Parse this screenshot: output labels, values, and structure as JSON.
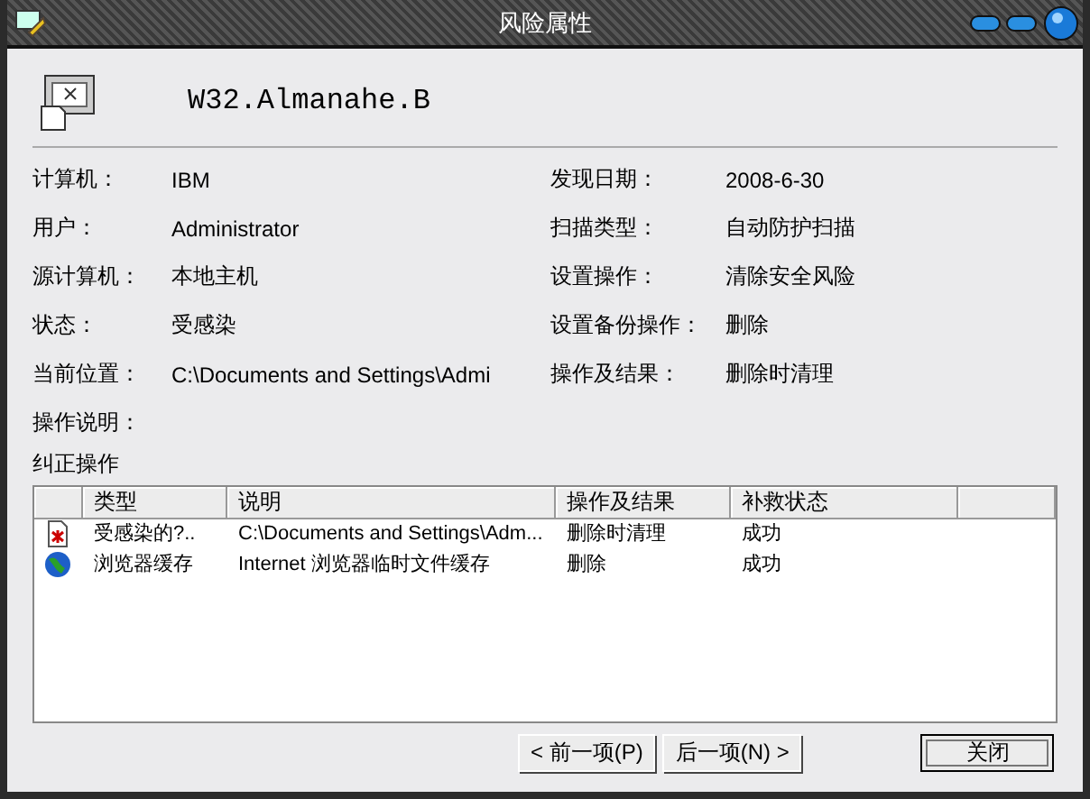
{
  "window": {
    "title": "风险属性"
  },
  "risk_name": "W32.Almanahe.B",
  "details_left": [
    {
      "label": "计算机：",
      "value": "IBM"
    },
    {
      "label": "用户：",
      "value": "Administrator"
    },
    {
      "label": "源计算机：",
      "value": "本地主机"
    },
    {
      "label": "状态：",
      "value": "受感染"
    },
    {
      "label": "当前位置：",
      "value": "C:\\Documents and Settings\\Admi"
    },
    {
      "label": "操作说明："
    }
  ],
  "details_right": [
    {
      "label": "发现日期：",
      "value": "2008-6-30"
    },
    {
      "label": "扫描类型：",
      "value": "自动防护扫描"
    },
    {
      "label": "设置操作：",
      "value": "清除安全风险"
    },
    {
      "label": "设置备份操作：",
      "value": "删除"
    },
    {
      "label": "操作及结果：",
      "value": "删除时清理"
    }
  ],
  "actions_label": "纠正操作",
  "table": {
    "columns": [
      "类型",
      "说明",
      "操作及结果",
      "补救状态"
    ],
    "rows": [
      {
        "kind": "file",
        "cells": [
          "受感染的?..",
          "C:\\Documents and Settings\\Adm...",
          "删除时清理",
          "成功"
        ]
      },
      {
        "kind": "globe",
        "cells": [
          "浏览器缓存",
          "Internet 浏览器临时文件缓存",
          "删除",
          "成功"
        ]
      }
    ]
  },
  "buttons": [
    {
      "label": "< 前一项(P)",
      "default": false
    },
    {
      "label": "后一项(N) >",
      "default": false
    },
    {
      "label": "关闭",
      "default": true
    }
  ]
}
